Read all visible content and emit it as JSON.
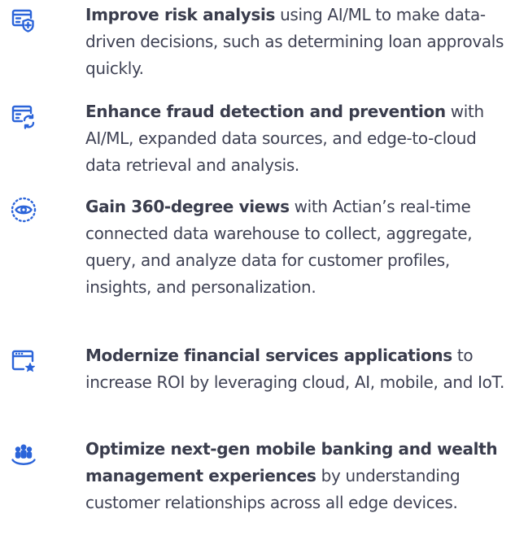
{
  "accent_color": "#2b64d9",
  "items": [
    {
      "icon": "document-shield-icon",
      "bold": "Improve risk analysis",
      "text": " using AI/ML to make data-driven decisions, such as determining loan approvals quickly."
    },
    {
      "icon": "document-refresh-icon",
      "bold": "Enhance fraud detection and prevention",
      "text": " with AI/ML, expanded data sources, and edge-to-cloud data retrieval and analysis."
    },
    {
      "icon": "eye-view-icon",
      "bold": "Gain 360-degree views",
      "text": " with Actian’s real-time connected data warehouse to collect, aggregate, query, and analyze data for customer profiles, insights, and personalization."
    },
    {
      "icon": "browser-star-icon",
      "bold": "Modernize financial services applications",
      "text": " to increase ROI by leveraging cloud, AI, mobile, and IoT."
    },
    {
      "icon": "people-group-icon",
      "bold": "Optimize next-gen mobile banking and wealth management experiences",
      "text": " by understanding customer relationships across all edge devices."
    }
  ]
}
